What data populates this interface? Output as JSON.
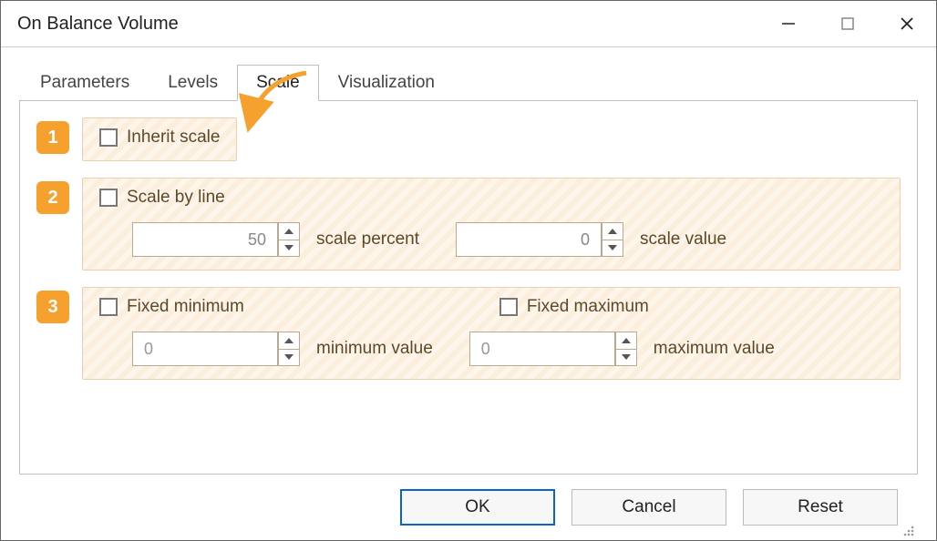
{
  "window": {
    "title": "On Balance Volume"
  },
  "tabs": [
    {
      "label": "Parameters"
    },
    {
      "label": "Levels"
    },
    {
      "label": "Scale"
    },
    {
      "label": "Visualization"
    }
  ],
  "active_tab": 2,
  "sections": {
    "s1": {
      "badge": "1",
      "inherit_label": "Inherit scale"
    },
    "s2": {
      "badge": "2",
      "scale_by_line_label": "Scale by line",
      "scale_percent_value": "50",
      "scale_percent_label": "scale percent",
      "scale_value_value": "0",
      "scale_value_label": "scale value"
    },
    "s3": {
      "badge": "3",
      "fixed_min_label": "Fixed minimum",
      "fixed_max_label": "Fixed maximum",
      "min_value": "0",
      "min_label": "minimum value",
      "max_value": "0",
      "max_label": "maximum value"
    }
  },
  "buttons": {
    "ok": "OK",
    "cancel": "Cancel",
    "reset": "Reset"
  },
  "colors": {
    "accent": "#f6a02e",
    "primary": "#0a64c8"
  }
}
